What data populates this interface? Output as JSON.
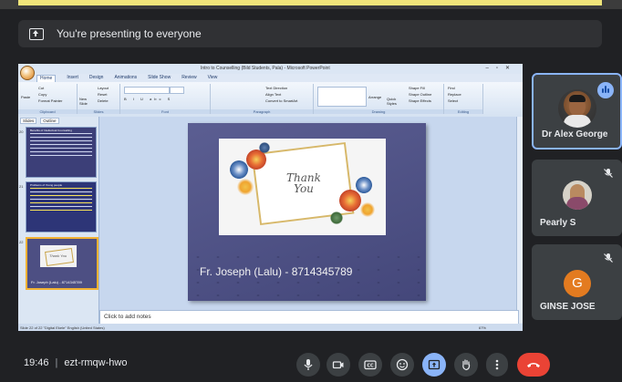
{
  "banner": {
    "text": "You're presenting to everyone"
  },
  "presented": {
    "window_title": "Intro to Counselling (Bild Students, Pala) - Microsoft PowerPoint",
    "ribbon_tabs": [
      "Home",
      "Insert",
      "Design",
      "Animations",
      "Slide Show",
      "Review",
      "View"
    ],
    "ribbon_groups": [
      "Clipboard",
      "Slides",
      "Font",
      "Paragraph",
      "Drawing",
      "Editing"
    ],
    "clipboard_items": [
      "Cut",
      "Copy",
      "Format Painter"
    ],
    "paste_label": "Paste",
    "slides_items": [
      "Layout",
      "Reset",
      "Delete"
    ],
    "new_slide_label": "New Slide",
    "drawing_items": [
      "Shape Fill",
      "Shape Outline",
      "Shape Effects"
    ],
    "arrange_label": "Arrange",
    "quick_styles_label": "Quick Styles",
    "editing_items": [
      "Find",
      "Replace",
      "Select"
    ],
    "paragraph_items": [
      "Text Direction",
      "Align Text",
      "Convert to SmartArt"
    ],
    "pane_tabs": [
      "Slides",
      "Outline"
    ],
    "thumbnails": [
      {
        "number": "20",
        "caption": "Benefits of Intellectual Counselling"
      },
      {
        "number": "21",
        "caption": "Problems of Young people"
      },
      {
        "number": "22",
        "caption": "Fr. Joseph (Lalu) - 8714345789"
      }
    ],
    "thumb3_text": "Thank You",
    "slide_thank_you": "Thank You",
    "slide_contact": "Fr. Joseph (Lalu)  - 8714345789",
    "notes_placeholder": "Click to add notes",
    "status_left": "Slide 22 of 22    \"Digital Ekele\"    English (United States)",
    "status_zoom": "67%"
  },
  "participants": [
    {
      "name": "Dr Alex George",
      "speaking": true
    },
    {
      "name": "Pearly S",
      "muted": true
    },
    {
      "name": "GINSE JOSE",
      "initial": "G",
      "muted": true,
      "avatar_color": "#e37b20"
    }
  ],
  "meeting": {
    "time": "19:46",
    "code": "ezt-rmqw-hwo"
  },
  "controls": [
    {
      "name": "microphone",
      "icon": "microphone-icon"
    },
    {
      "name": "camera",
      "icon": "camera-icon"
    },
    {
      "name": "captions",
      "icon": "captions-icon"
    },
    {
      "name": "reactions",
      "icon": "emoji-icon"
    },
    {
      "name": "present",
      "icon": "present-icon"
    },
    {
      "name": "raise-hand",
      "icon": "hand-icon"
    },
    {
      "name": "more-options",
      "icon": "more-icon"
    },
    {
      "name": "leave-call",
      "icon": "hang-up-icon"
    }
  ],
  "colors": {
    "background": "#202124",
    "tile": "#3c4043",
    "accent": "#8ab4f8",
    "hangup": "#ea4335"
  }
}
